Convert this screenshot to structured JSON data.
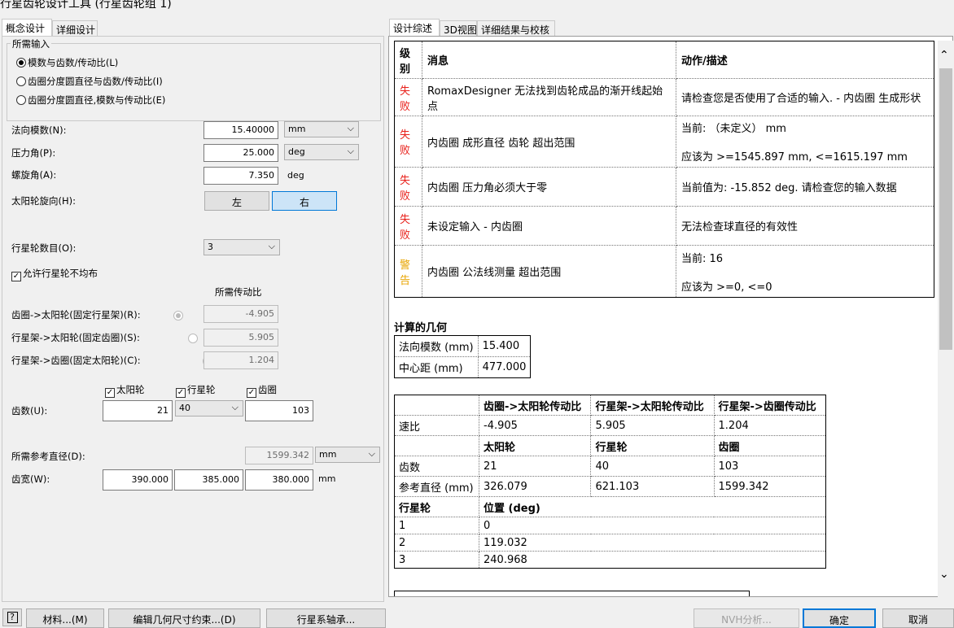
{
  "window": {
    "title": "行星齿轮设计工具 (行星齿轮组 1)"
  },
  "left_tabs": [
    "概念设计",
    "详细设计"
  ],
  "right_tabs": [
    "设计综述",
    "3D视图",
    "详细结果与校核"
  ],
  "inputs": {
    "group_title": "所需输入",
    "modes": [
      "模数与齿数/传动比(L)",
      "齿圈分度圆直径与齿数/传动比(I)",
      "齿圈分度圆直径,模数与传动比(E)"
    ],
    "normal_module_label": "法向模数(N):",
    "normal_module_value": "15.40000",
    "normal_module_unit": "mm",
    "pressure_angle_label": "压力角(P):",
    "pressure_angle_value": "25.000",
    "pressure_angle_unit": "deg",
    "helix_angle_label": "螺旋角(A):",
    "helix_angle_value": "7.350",
    "helix_angle_unit": "deg",
    "sun_hand_label": "太阳轮旋向(H):",
    "hand_left": "左",
    "hand_right": "右",
    "num_planets_label": "行星轮数目(O):",
    "num_planets_value": "3",
    "allow_uneven_label": "允许行星轮不均布",
    "required_ratio_header": "所需传动比",
    "ratio_rows": [
      {
        "label": "齿圈->太阳轮(固定行星架)(R):",
        "value": "-4.905"
      },
      {
        "label": "行星架->太阳轮(固定齿圈)(S):",
        "value": "5.905"
      },
      {
        "label": "行星架->齿圈(固定太阳轮)(C):",
        "value": "1.204"
      }
    ],
    "chk_sun": "太阳轮",
    "chk_planet": "行星轮",
    "chk_ring": "齿圈",
    "teeth_label": "齿数(U):",
    "teeth_sun": "21",
    "teeth_planet": "40",
    "teeth_ring": "103",
    "ref_dia_label": "所需参考直径(D):",
    "ref_dia_value": "1599.342",
    "ref_dia_unit": "mm",
    "face_width_label": "齿宽(W):",
    "fw_sun": "390.000",
    "fw_planet": "385.000",
    "fw_ring": "380.000",
    "fw_unit": "mm"
  },
  "messages": {
    "headers": {
      "level": "级别",
      "message": "消息",
      "action": "动作/描述"
    },
    "rows": [
      {
        "level": "失败",
        "message": "RomaxDesigner 无法找到齿轮成品的渐开线起始点",
        "action": "请检查您是否使用了合适的输入. - 内齿圈 生成形状",
        "action2": ""
      },
      {
        "level": "失败",
        "message": "内齿圈 成形直径 齿轮 超出范围",
        "action": "当前: （未定义） mm",
        "action2": "应该为 >=1545.897 mm, <=1615.197 mm"
      },
      {
        "level": "失败",
        "message": "内齿圈 压力角必须大于零",
        "action": "当前值为: -15.852 deg. 请检查您的输入数据",
        "action2": ""
      },
      {
        "level": "失败",
        "message": "未设定输入 - 内齿圈",
        "action": "无法检查球直径的有效性",
        "action2": ""
      },
      {
        "level": "警告",
        "message": "内齿圈 公法线测量 超出范围",
        "action": "当前: 16",
        "action2": "应该为 >=0, <=0"
      }
    ]
  },
  "geometry": {
    "title": "计算的几何",
    "normal_module_label": "法向模数 (mm)",
    "normal_module": "15.400",
    "center_dist_label": "中心距 (mm)",
    "center_dist": "477.000"
  },
  "results": {
    "ratio_headers": [
      "齿圈->太阳轮传动比",
      "行星架->太阳轮传动比",
      "行星架->齿圈传动比"
    ],
    "speed_ratio_label": "速比",
    "speed_ratios": [
      "-4.905",
      "5.905",
      "1.204"
    ],
    "gear_headers": [
      "太阳轮",
      "行星轮",
      "齿圈"
    ],
    "teeth_label": "齿数",
    "teeth": [
      "21",
      "40",
      "103"
    ],
    "ref_dia_label": "参考直径 (mm)",
    "ref_dia": [
      "326.079",
      "621.103",
      "1599.342"
    ],
    "planet_label": "行星轮",
    "position_label": "位置 (deg)",
    "planets": [
      {
        "n": "1",
        "pos": "0"
      },
      {
        "n": "2",
        "pos": "119.032"
      },
      {
        "n": "3",
        "pos": "240.968"
      }
    ]
  },
  "footer": {
    "help": "?",
    "materials": "材料...(M)",
    "edit_geo": "编辑几何尺寸约束...(D)",
    "bearing": "行星系轴承...",
    "nvh": "NVH分析...",
    "ok": "确定",
    "cancel": "取消"
  },
  "colors": {
    "fail": "#e8201a",
    "warn": "#e8a400",
    "accent": "#0078d7"
  }
}
